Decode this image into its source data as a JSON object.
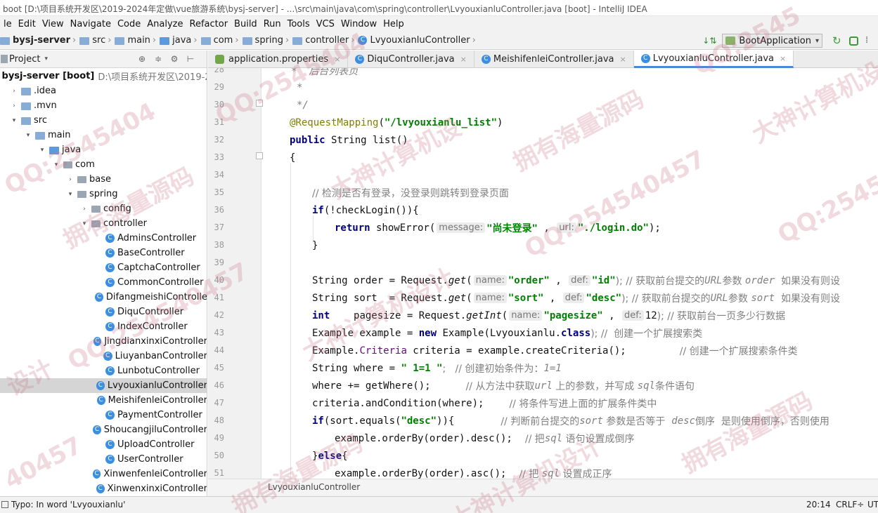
{
  "window": {
    "title": "boot [D:\\项目系统开发区\\2019-2024年定做\\vue旅游系统\\bysj-server] - ...\\src\\main\\java\\com\\spring\\controller\\LvyouxianluController.java [boot] - IntelliJ IDEA"
  },
  "menu": [
    "le",
    "Edit",
    "View",
    "Navigate",
    "Code",
    "Analyze",
    "Refactor",
    "Build",
    "Run",
    "Tools",
    "VCS",
    "Window",
    "Help"
  ],
  "breadcrumb": {
    "items": [
      "bysj-server",
      "src",
      "main",
      "java",
      "com",
      "spring",
      "controller",
      "LvyouxianluController"
    ]
  },
  "run_config": {
    "label": "BootApplication"
  },
  "project_panel": {
    "title": "Project"
  },
  "tree": [
    {
      "label": "bysj-server [boot]",
      "dim": "D:\\项目系统开发区\\2019-2024",
      "arrow": "▾",
      "icon": "folder"
    },
    {
      "label": ".idea",
      "arrow": "›",
      "icon": "folder"
    },
    {
      "label": ".mvn",
      "arrow": "›",
      "icon": "folder"
    },
    {
      "label": "src",
      "arrow": "▾",
      "icon": "folder"
    },
    {
      "label": "main",
      "arrow": "▾",
      "icon": "folder"
    },
    {
      "label": "java",
      "arrow": "▾",
      "icon": "folder-blue"
    },
    {
      "label": "com",
      "arrow": "▾",
      "icon": "package"
    },
    {
      "label": "base",
      "arrow": "›",
      "icon": "package"
    },
    {
      "label": "spring",
      "arrow": "▾",
      "icon": "package"
    },
    {
      "label": "config",
      "arrow": "›",
      "icon": "package"
    },
    {
      "label": "controller",
      "arrow": "▾",
      "icon": "package"
    },
    {
      "label": "AdminsController",
      "icon": "class"
    },
    {
      "label": "BaseController",
      "icon": "class"
    },
    {
      "label": "CaptchaController",
      "icon": "class"
    },
    {
      "label": "CommonController",
      "icon": "class"
    },
    {
      "label": "DifangmeishiControlle",
      "icon": "class"
    },
    {
      "label": "DiquController",
      "icon": "class"
    },
    {
      "label": "IndexController",
      "icon": "class"
    },
    {
      "label": "JingdianxinxiController",
      "icon": "class"
    },
    {
      "label": "LiuyanbanController",
      "icon": "class"
    },
    {
      "label": "LunbotuController",
      "icon": "class"
    },
    {
      "label": "LvyouxianluController",
      "icon": "class",
      "selected": true
    },
    {
      "label": "MeishifenleiController",
      "icon": "class"
    },
    {
      "label": "PaymentController",
      "icon": "class"
    },
    {
      "label": "ShoucangjiluController",
      "icon": "class"
    },
    {
      "label": "UploadController",
      "icon": "class"
    },
    {
      "label": "UserController",
      "icon": "class"
    },
    {
      "label": "XinwenfenleiController",
      "icon": "class"
    },
    {
      "label": "XinwenxinxiController",
      "icon": "class"
    }
  ],
  "tabs": [
    {
      "label": "application.properties",
      "icon": "properties"
    },
    {
      "label": "DiquController.java",
      "icon": "class"
    },
    {
      "label": "MeishifenleiController.java",
      "icon": "class"
    },
    {
      "label": "LvyouxianluController.java",
      "icon": "class",
      "active": true
    }
  ],
  "editor": {
    "line_numbers": [
      "28",
      "29",
      "30",
      "31",
      "32",
      "33",
      "34",
      "35",
      "36",
      "37",
      "38",
      "39",
      "40",
      "41",
      "42",
      "43",
      "44",
      "45",
      "46",
      "47",
      "48",
      "49",
      "50",
      "51"
    ],
    "code": {
      "l28": "*  后台列表页",
      "l29": "*",
      "l30": "*/",
      "l31_ann": "@RequestMapping",
      "l31_str": "\"/lvyouxianlu_list\"",
      "l32_kw": "public",
      "l32_rest": " String list()",
      "l33": "{",
      "l35": "// 检测是否有登录，没登录则跳转到登录页面",
      "l36_kw": "if",
      "l36_rest": "(!checkLogin()){",
      "l37_kw": "return",
      "l37_call": " showError(",
      "l37_hint1": "message:",
      "l37_str1": "\"尚未登录\"",
      "l37_hint2": "url:",
      "l37_str2": "\"./login.do\"",
      "l37_end": ");",
      "l38": "}",
      "l40_a": "String order = Request.",
      "l40_m": "get",
      "l40_hint1": "name:",
      "l40_str1": "\"order\"",
      "l40_hint2": "def:",
      "l40_str2": "\"id\"",
      "l40_cm1": "); // 获取前台提交的",
      "l40_cmi1": "URL",
      "l40_cm2": "参数 ",
      "l40_cmi2": "order",
      "l40_cm3": "  如果没有则设",
      "l41_a": "String sort  = Request.",
      "l41_m": "get",
      "l41_hint1": "name:",
      "l41_str1": "\"sort\"",
      "l41_hint2": "def:",
      "l41_str2": "\"desc\"",
      "l41_cm1": "); // 获取前台提交的",
      "l41_cmi1": "URL",
      "l41_cm2": "参数 ",
      "l41_cmi2": "sort",
      "l41_cm3": "  如果没有则设",
      "l42_kw": "int",
      "l42_a": "    pagesize = Request.",
      "l42_m": "getInt",
      "l42_hint1": "name:",
      "l42_str1": "\"pagesize\"",
      "l42_hint2": "def:",
      "l42_num": "12",
      "l42_cm": "); // 获取前台一页多少行数据",
      "l43_a": "Example example = ",
      "l43_kw": "new",
      "l43_b": " Example(Lvyouxianlu.",
      "l43_kw2": "class",
      "l43_c": "); //  创建一个扩展搜索类",
      "l44_a": "Example.",
      "l44_b": "Criteria",
      "l44_c": " criteria = example.createCriteria();",
      "l44_cm": "// 创建一个扩展搜索条件类",
      "l45_a": "String where = ",
      "l45_str": "\" 1=1 \"",
      "l45_cm": ";   // 创建初始条件为：",
      "l45_cmi": "1=1",
      "l46_a": "where += getWhere();",
      "l46_cm1": "// 从方法中获取",
      "l46_cmi1": "url",
      "l46_cm2": " 上的参数，并写成 ",
      "l46_cmi2": "sql",
      "l46_cm3": "条件语句",
      "l47_a": "criteria.andCondition(where);",
      "l47_cm": "// 将条件写进上面的扩展条件类中",
      "l48_kw": "if",
      "l48_a": "(sort.equals(",
      "l48_str": "\"desc\"",
      "l48_b": ")){",
      "l48_cm1": "// 判断前台提交的",
      "l48_cmi1": "sort",
      "l48_cm2": " 参数是否等于  ",
      "l48_cmi2": "desc",
      "l48_cm3": "倒序  是则使用倒序，否则使用",
      "l49_a": "example.orderBy(order).desc();",
      "l49_cm1": "// 把",
      "l49_cmi": "sql",
      "l49_cm2": " 语句设置成倒序",
      "l50_a": "}",
      "l50_kw": "else",
      "l50_b": "{",
      "l51_a": "example.orderBy(order).asc();",
      "l51_cm1": "// 把 ",
      "l51_cmi": "sql",
      "l51_cm2": " 设置成正序"
    }
  },
  "editor_footer": {
    "breadcrumb": "LvyouxianluController"
  },
  "status": {
    "message": "Typo: In word 'Lvyouxianlu'",
    "position": "20:14",
    "line_ending": "CRLF÷",
    "encoding": "UT"
  },
  "watermarks": [
    "QQ:2545404",
    "大神计算机设",
    "拥有海量源码",
    "QQ:254540457",
    "大神计算机设计",
    "拥有海量源码",
    "QQ:254540457",
    "大神计算机设计",
    "拥有海量源码",
    "QQ:254540457",
    "大神计算机设计",
    "拥有海量源码",
    "QQ:2545404",
    "设计",
    "QQ:2545",
    "40457"
  ]
}
